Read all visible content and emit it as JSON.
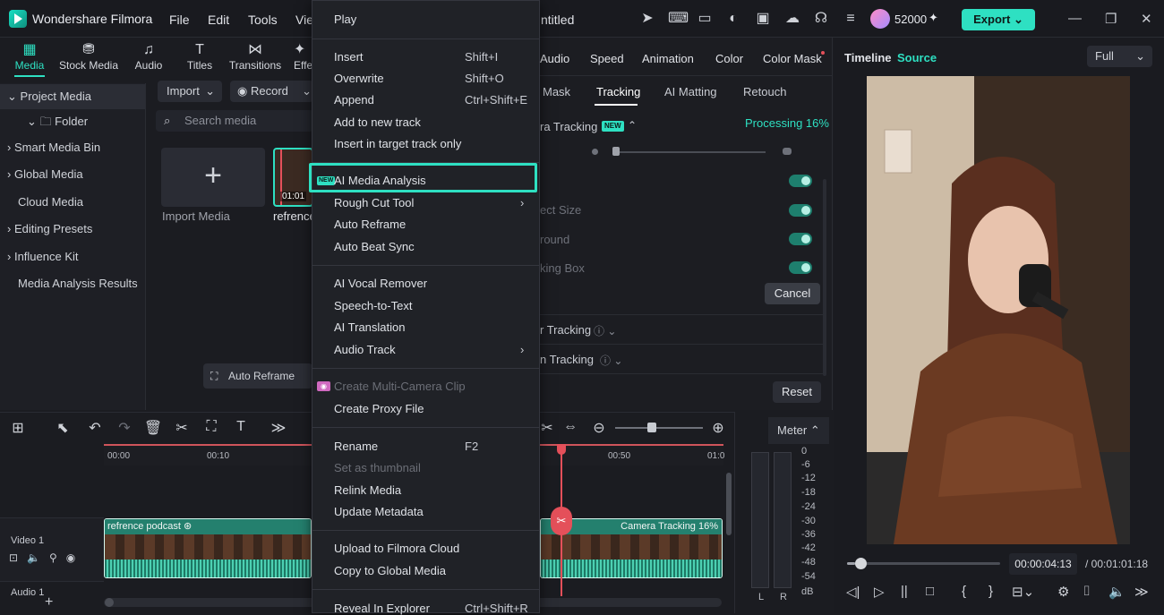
{
  "app": {
    "title": "Wondershare Filmora",
    "menus": [
      "File",
      "Edit",
      "Tools",
      "Vie"
    ],
    "project_name": "ntitled",
    "credits": "52000",
    "export_label": "Export"
  },
  "toolbar": {
    "tabs": [
      {
        "label": "Media",
        "icon": "media-icon"
      },
      {
        "label": "Stock Media",
        "icon": "stock-media-icon"
      },
      {
        "label": "Audio",
        "icon": "music-note-icon"
      },
      {
        "label": "Titles",
        "icon": "titles-icon"
      },
      {
        "label": "Transitions",
        "icon": "transitions-icon"
      },
      {
        "label": "Effe",
        "icon": "effects-icon"
      }
    ]
  },
  "sidebar": {
    "items": [
      {
        "label": "Project Media",
        "chevron": "⌄"
      },
      {
        "label": "Folder",
        "chevron": "⌄"
      },
      {
        "label": "Smart Media Bin",
        "chevron": "›"
      },
      {
        "label": "Global Media",
        "chevron": "›"
      },
      {
        "label": "Cloud Media",
        "chevron": ""
      },
      {
        "label": "Editing Presets",
        "chevron": "›"
      },
      {
        "label": "Influence Kit",
        "chevron": "›"
      },
      {
        "label": "Media Analysis Results",
        "chevron": ""
      }
    ]
  },
  "media": {
    "import_label": "Import",
    "record_label": "Record",
    "search_placeholder": "Search media",
    "import_card_label": "Import Media",
    "clip_name": "refrence",
    "clip_duration": "01:01",
    "auto_reframe_label": "Auto Reframe"
  },
  "context_menu": {
    "items": [
      {
        "label": "Play",
        "shortcut": ""
      },
      {
        "label": "Insert",
        "shortcut": "Shift+I"
      },
      {
        "label": "Overwrite",
        "shortcut": "Shift+O"
      },
      {
        "label": "Append",
        "shortcut": "Ctrl+Shift+E"
      },
      {
        "label": "Add to new track",
        "shortcut": ""
      },
      {
        "label": "Insert in target track only",
        "shortcut": ""
      },
      {
        "label": "AI Media Analysis",
        "shortcut": "",
        "badge": "NEW"
      },
      {
        "label": "Rough Cut Tool",
        "shortcut": "›"
      },
      {
        "label": "Auto Reframe",
        "shortcut": ""
      },
      {
        "label": "Auto Beat Sync",
        "shortcut": ""
      },
      {
        "label": "AI Vocal Remover",
        "shortcut": ""
      },
      {
        "label": "Speech-to-Text",
        "shortcut": ""
      },
      {
        "label": "AI Translation",
        "shortcut": ""
      },
      {
        "label": "Audio Track",
        "shortcut": "›"
      },
      {
        "label": "Create Multi-Camera Clip",
        "shortcut": "",
        "disabled": true
      },
      {
        "label": "Create Proxy File",
        "shortcut": ""
      },
      {
        "label": "Rename",
        "shortcut": "F2"
      },
      {
        "label": "Set as thumbnail",
        "shortcut": "",
        "disabled": true
      },
      {
        "label": "Relink Media",
        "shortcut": ""
      },
      {
        "label": "Update Metadata",
        "shortcut": ""
      },
      {
        "label": "Upload to Filmora Cloud",
        "shortcut": ""
      },
      {
        "label": "Copy to Global Media",
        "shortcut": ""
      },
      {
        "label": "Reveal In Explorer",
        "shortcut": "Ctrl+Shift+R"
      }
    ]
  },
  "properties": {
    "tabs": [
      "Audio",
      "Speed",
      "Animation",
      "Color",
      "Color Mask"
    ],
    "subtabs": [
      "Mask",
      "Tracking",
      "AI Matting",
      "Retouch"
    ],
    "camera_tracking_label": "ra Tracking",
    "new_badge": "NEW",
    "processing_label": "Processing 16%",
    "rows": [
      "ect Size",
      "round",
      "king Box"
    ],
    "cancel_label": "Cancel",
    "tracking_1": "r Tracking",
    "tracking_2": "n Tracking",
    "reset_label": "Reset"
  },
  "player": {
    "tab_timeline": "Timeline",
    "tab_source": "Source",
    "quality": "Full",
    "current_time": "00:00:04:13",
    "total_time": "/ 00:01:01:18",
    "progress": 0.05
  },
  "timeline": {
    "ruler_ticks": [
      "00:00",
      "00:10",
      "00:50",
      "01:0"
    ],
    "track_video_label": "Video 1",
    "track_audio_label": "Audio 1",
    "clip_left_title": "refrence podcast",
    "clip_right_title": "Camera Tracking 16%",
    "meter_label": "Meter",
    "meter_scale": [
      "0",
      "-6",
      "-12",
      "-18",
      "-24",
      "-30",
      "-36",
      "-42",
      "-48",
      "-54",
      "dB"
    ],
    "meter_channels": [
      "L",
      "R"
    ]
  },
  "colors": {
    "accent": "#2ee0c2",
    "playhead": "#e4505a",
    "clip": "#1e7865"
  }
}
